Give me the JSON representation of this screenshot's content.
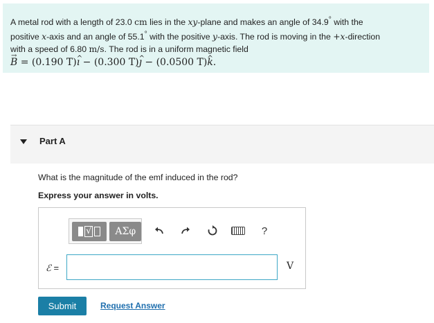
{
  "problem": {
    "line1_a": "A metal rod with a length of 23.0 ",
    "unit_cm": "cm",
    "line1_b": " lies in the ",
    "plane_xy": "xy",
    "line1_c": "-plane and makes an angle of 34.9",
    "deg": "°",
    "line1_d": " with the",
    "line2_a": "positive ",
    "axis_x": "x",
    "line2_b": "-axis and an angle of 55.1",
    "line2_c": " with the positive ",
    "axis_y": "y",
    "line2_d": "-axis. The rod is moving in the ",
    "dir": "+x",
    "line2_e": "-direction",
    "line3_a": "with a speed of 6.80 ",
    "unit_speed": "m/s",
    "line3_b": ". The rod is in a uniform magnetic field",
    "field_B": "B",
    "field_eq": " = (0.190 T)",
    "i_hat": "ı",
    "field_mid1": " − (0.300 T)",
    "j_hat": "ȷ",
    "field_mid2": " − (0.0500 T)",
    "k_hat": "k",
    "field_end": "."
  },
  "part": {
    "title": "Part A"
  },
  "question": "What is the magnitude of the emf induced in the rod?",
  "instruction": "Express your answer in volts.",
  "toolbar": {
    "templates_root": "√",
    "symbols_label": "ΑΣφ",
    "undo_icon": "undo-arrow",
    "redo_icon": "redo-arrow",
    "reset_icon": "reset",
    "keyboard_icon": "keyboard",
    "help_label": "?"
  },
  "answer": {
    "label_symbol": "ℰ",
    "label_eq": " =",
    "value": "",
    "unit": "V"
  },
  "actions": {
    "submit_label": "Submit",
    "request_label": "Request Answer"
  }
}
